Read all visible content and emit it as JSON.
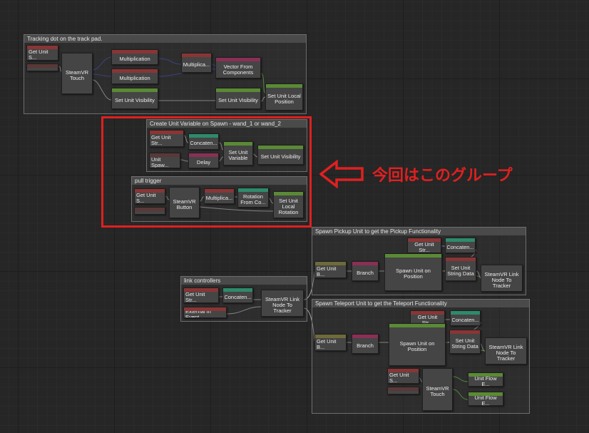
{
  "colors": {
    "highlight": "#e02020",
    "wire": "#a8a8a8",
    "wire_blue": "#3a46a8",
    "wire_green": "#5fae3c"
  },
  "annotation": {
    "text": "今回はこのグループ",
    "icon": "left-arrow-icon"
  },
  "groups": [
    {
      "id": "tracking",
      "title": "Tracking dot on the track pad."
    },
    {
      "id": "create",
      "title": "Create Unit Variable on Spawn - wand_1 or wand_2"
    },
    {
      "id": "pull",
      "title": "pull trigger"
    },
    {
      "id": "pickup",
      "title": "Spawn Pickup Unit to get the Pickup Functionality"
    },
    {
      "id": "link",
      "title": "link controllers"
    },
    {
      "id": "teleport",
      "title": "Spawn Teleport Unit to get the Teleport Functionality"
    }
  ],
  "nodes": [
    {
      "name": "node-get-unit-string-1",
      "label": "Get Unit S..."
    },
    {
      "name": "node-steamvr-touch",
      "label": "SteamVR Touch"
    },
    {
      "name": "node-multiplication-1",
      "label": "Multiplication"
    },
    {
      "name": "node-multiplication-2",
      "label": "Multiplication"
    },
    {
      "name": "node-multiplication-3",
      "label": "Multiplica..."
    },
    {
      "name": "node-vector-from-components",
      "label": "Vector From Components"
    },
    {
      "name": "node-set-unit-visibility-1",
      "label": "Set Unit Visibility"
    },
    {
      "name": "node-set-unit-visibility-2",
      "label": "Set Unit Visibility"
    },
    {
      "name": "node-set-unit-local-position",
      "label": "Set Unit Local Position"
    },
    {
      "name": "node-get-unit-string-2",
      "label": "Get Unit Str..."
    },
    {
      "name": "node-concatenate-1",
      "label": "Concaten..."
    },
    {
      "name": "node-unit-spawn",
      "label": "Unit Spaw..."
    },
    {
      "name": "node-delay",
      "label": "Delay"
    },
    {
      "name": "node-set-unit-variable",
      "label": "Set Unit Variable"
    },
    {
      "name": "node-set-unit-visibility-3",
      "label": "Set Unit Visibility"
    },
    {
      "name": "node-get-unit-string-3",
      "label": "Get Unit S..."
    },
    {
      "name": "node-steamvr-button",
      "label": "SteamVR Button"
    },
    {
      "name": "node-multiplication-4",
      "label": "Multiplica..."
    },
    {
      "name": "node-rotation-from-components",
      "label": "Rotation From Co..."
    },
    {
      "name": "node-set-unit-local-rotation",
      "label": "Set Unit Local Rotation"
    },
    {
      "name": "node-get-unit-string-4",
      "label": "Get Unit Str..."
    },
    {
      "name": "node-concatenate-2",
      "label": "Concaten..."
    },
    {
      "name": "node-get-unit-bool-1",
      "label": "Get Unit B..."
    },
    {
      "name": "node-branch-1",
      "label": "Branch"
    },
    {
      "name": "node-spawn-unit-on-position-1",
      "label": "Spawn Unit on Position"
    },
    {
      "name": "node-set-unit-string-data-1",
      "label": "Set Unit String Data"
    },
    {
      "name": "node-steamvr-link-node-1",
      "label": "SteamVR Link Node To Tracker"
    },
    {
      "name": "node-get-unit-string-5",
      "label": "Get Unit Str..."
    },
    {
      "name": "node-concatenate-3",
      "label": "Concaten..."
    },
    {
      "name": "node-external-in-event",
      "label": "External In Event"
    },
    {
      "name": "node-steamvr-link-node-2",
      "label": "SteamVR Link Node To Tracker"
    },
    {
      "name": "node-get-unit-string-6",
      "label": "Get Unit Str..."
    },
    {
      "name": "node-concatenate-4",
      "label": "Concaten..."
    },
    {
      "name": "node-get-unit-bool-2",
      "label": "Get Unit B..."
    },
    {
      "name": "node-branch-2",
      "label": "Branch"
    },
    {
      "name": "node-spawn-unit-on-position-2",
      "label": "Spawn Unit on Position"
    },
    {
      "name": "node-set-unit-string-data-2",
      "label": "Set Unit String Data"
    },
    {
      "name": "node-steamvr-link-node-3",
      "label": "SteamVR Link Node To Tracker"
    },
    {
      "name": "node-get-unit-string-7",
      "label": "Get Unit S..."
    },
    {
      "name": "node-steamvr-touch-2",
      "label": "SteamVR Touch"
    },
    {
      "name": "node-unit-flow-event-1",
      "label": "Unit Flow E..."
    },
    {
      "name": "node-unit-flow-event-2",
      "label": "Unit Flow E..."
    }
  ]
}
